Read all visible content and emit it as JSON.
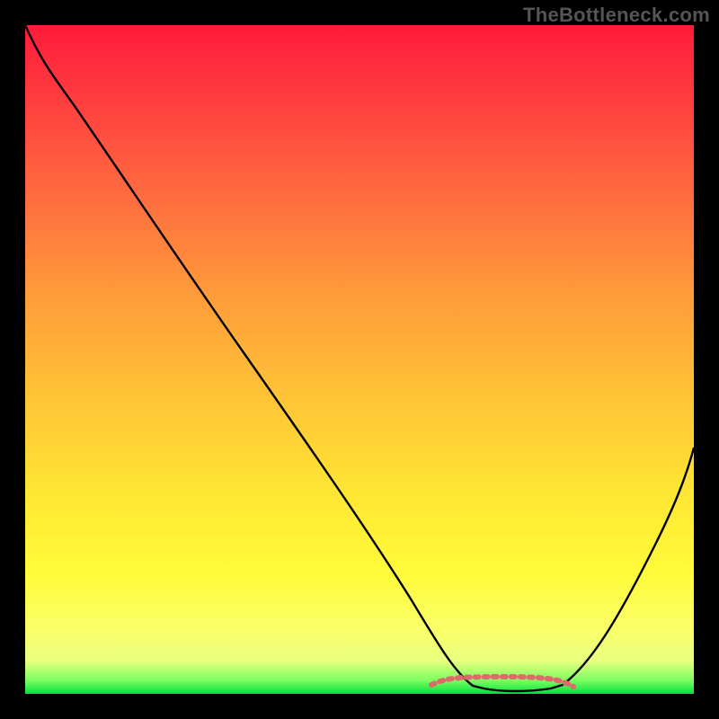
{
  "watermark": "TheBottleneck.com",
  "chart_data": {
    "type": "line",
    "title": "",
    "xlabel": "",
    "ylabel": "",
    "xlim": [
      0,
      100
    ],
    "ylim": [
      0,
      100
    ],
    "background_gradient": {
      "direction": "vertical",
      "stops": [
        {
          "pct": 0,
          "color": "#ff1a3a"
        },
        {
          "pct": 25,
          "color": "#ff6a3f"
        },
        {
          "pct": 55,
          "color": "#ffc236"
        },
        {
          "pct": 82,
          "color": "#fffb3a"
        },
        {
          "pct": 100,
          "color": "#00e040"
        }
      ]
    },
    "series": [
      {
        "name": "bottleneck-curve",
        "color": "#000000",
        "x": [
          0,
          5,
          10,
          20,
          30,
          40,
          50,
          57,
          62,
          68,
          74,
          80,
          85,
          90,
          95,
          100
        ],
        "y": [
          100,
          93,
          88,
          75,
          62,
          49,
          36,
          23,
          12,
          4,
          1,
          1,
          5,
          15,
          28,
          42
        ]
      }
    ],
    "highlight_band": {
      "comment": "pink dashed hump near bottom between x~60 and x~80",
      "color": "#e46a6a",
      "x": [
        58,
        62,
        66,
        70,
        74,
        78,
        82
      ],
      "y": [
        2.2,
        1.2,
        0.9,
        0.8,
        0.9,
        1.2,
        2.5
      ]
    }
  }
}
